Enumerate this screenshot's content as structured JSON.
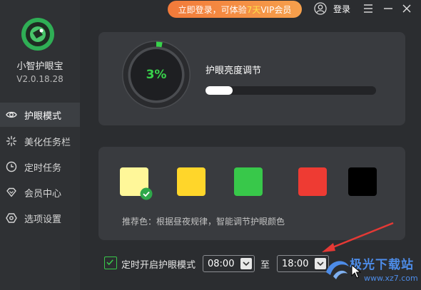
{
  "app": {
    "name": "小智护眼宝",
    "version": "V2.0.18.28"
  },
  "sidebar": {
    "items": [
      {
        "label": "护眼模式",
        "icon": "eye-icon",
        "active": true
      },
      {
        "label": "美化任务栏",
        "icon": "sparkle-icon",
        "active": false
      },
      {
        "label": "定时任务",
        "icon": "clock-icon",
        "active": false
      },
      {
        "label": "会员中心",
        "icon": "diamond-icon",
        "active": false
      },
      {
        "label": "选项设置",
        "icon": "settings-hexagon-icon",
        "active": false
      }
    ]
  },
  "topbar": {
    "vip_prefix": "立即登录，可体验",
    "vip_highlight": "7天",
    "vip_suffix": "VIP会员",
    "login_label": "登录"
  },
  "brightness": {
    "percent_label": "3%",
    "percent_value": 3,
    "label": "护眼亮度调节",
    "slider_value_pct": 16
  },
  "colors": {
    "accent_green": "#38d24b",
    "swatches": [
      "#fff799",
      "#ffd62a",
      "#38c84a",
      "#ee3b33",
      "#000000"
    ],
    "selected_index": 0
  },
  "hint": "推荐色：根据昼夜规律，智能调节护眼颜色",
  "schedule": {
    "checked": true,
    "label": "定时开启护眼模式",
    "start_time": "08:00",
    "separator": "至",
    "end_time": "18:00"
  },
  "watermark": {
    "title": "极光下载站",
    "url": "www.xz7.com"
  }
}
